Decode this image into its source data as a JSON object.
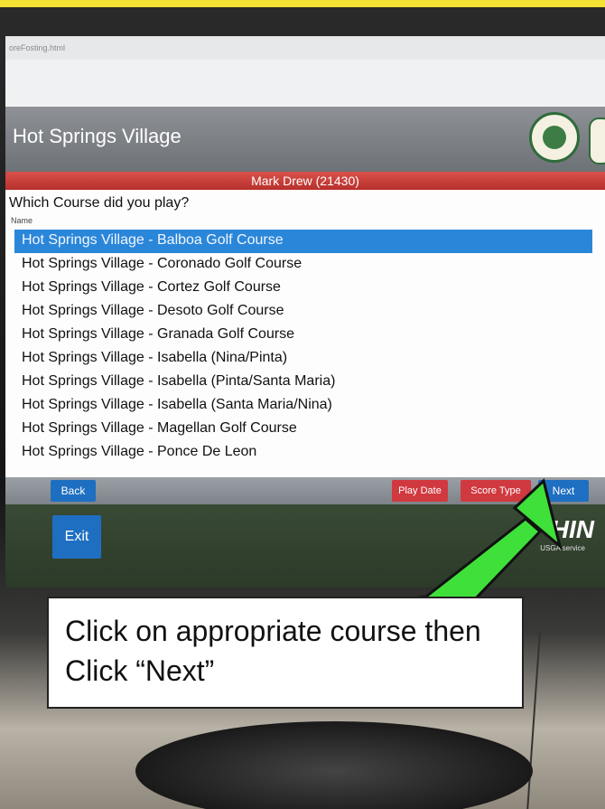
{
  "browser": {
    "url_fragment": "oreFosting.html"
  },
  "header": {
    "title": "Hot Springs Village"
  },
  "golfer_bar": {
    "label": "Mark Drew (21430)"
  },
  "course_select": {
    "question": "Which Course did you play?",
    "column_header": "Name",
    "courses": [
      "Hot Springs Village - Balboa Golf Course",
      "Hot Springs Village - Coronado Golf Course",
      "Hot Springs Village - Cortez Golf Course",
      "Hot Springs Village - Desoto Golf Course",
      "Hot Springs Village - Granada Golf Course",
      "Hot Springs Village - Isabella (Nina/Pinta)",
      "Hot Springs Village - Isabella (Pinta/Santa Maria)",
      "Hot Springs Village - Isabella (Santa Maria/Nina)",
      "Hot Springs Village - Magellan Golf Course",
      "Hot Springs Village - Ponce De Leon"
    ],
    "selected_index": 0
  },
  "buttons": {
    "back": "Back",
    "play_date": "Play Date",
    "score_type": "Score Type",
    "next": "Next",
    "exit": "Exit"
  },
  "branding": {
    "ghin": "HIN",
    "usga": "USGA service"
  },
  "callout": {
    "text": "Click on appropriate course then Click “Next”"
  },
  "colors": {
    "selected_row": "#2a86d9",
    "red_bar": "#c23a35",
    "blue_button": "#1e6fc1",
    "arrow": "#3fe03a"
  }
}
